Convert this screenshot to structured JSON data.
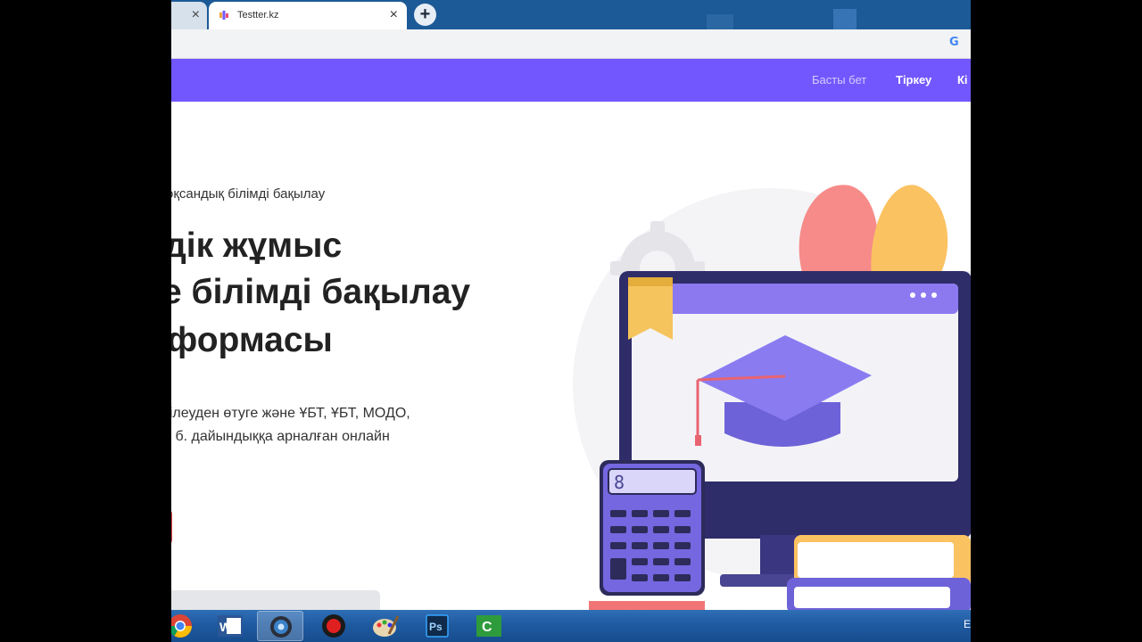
{
  "browser": {
    "active_tab_title": "Testter.kz",
    "close_symbol": "×",
    "new_tab_symbol": "+",
    "google_icon_glyph": "G"
  },
  "nav": {
    "home": "Басты бет",
    "register": "Тіркеу",
    "login": "Кі"
  },
  "hero": {
    "subtitle": "Тоқсандық білімді бақылау",
    "title_lines": [
      "дік жұмыс",
      "е білімді бақылау",
      "тформасы"
    ],
    "description_lines": [
      "гілеуден өтуге және ҰБТ, ҰБТ, МОДО,",
      "т. б. дайындыққа арналған онлайн"
    ]
  },
  "illustration": {
    "calculator_display": "8"
  },
  "taskbar": {
    "apps": [
      "chrome-icon",
      "word-icon",
      "webcam-icon",
      "record-icon",
      "paint-icon",
      "photoshop-icon",
      "camtasia-icon"
    ],
    "word_label": "W",
    "photoshop_label": "Ps",
    "camtasia_label": "C",
    "language": "E"
  },
  "colors": {
    "brand": "#7357fe",
    "tab_strip": "#1c5a97",
    "taskbar": "#1f5aa0"
  }
}
